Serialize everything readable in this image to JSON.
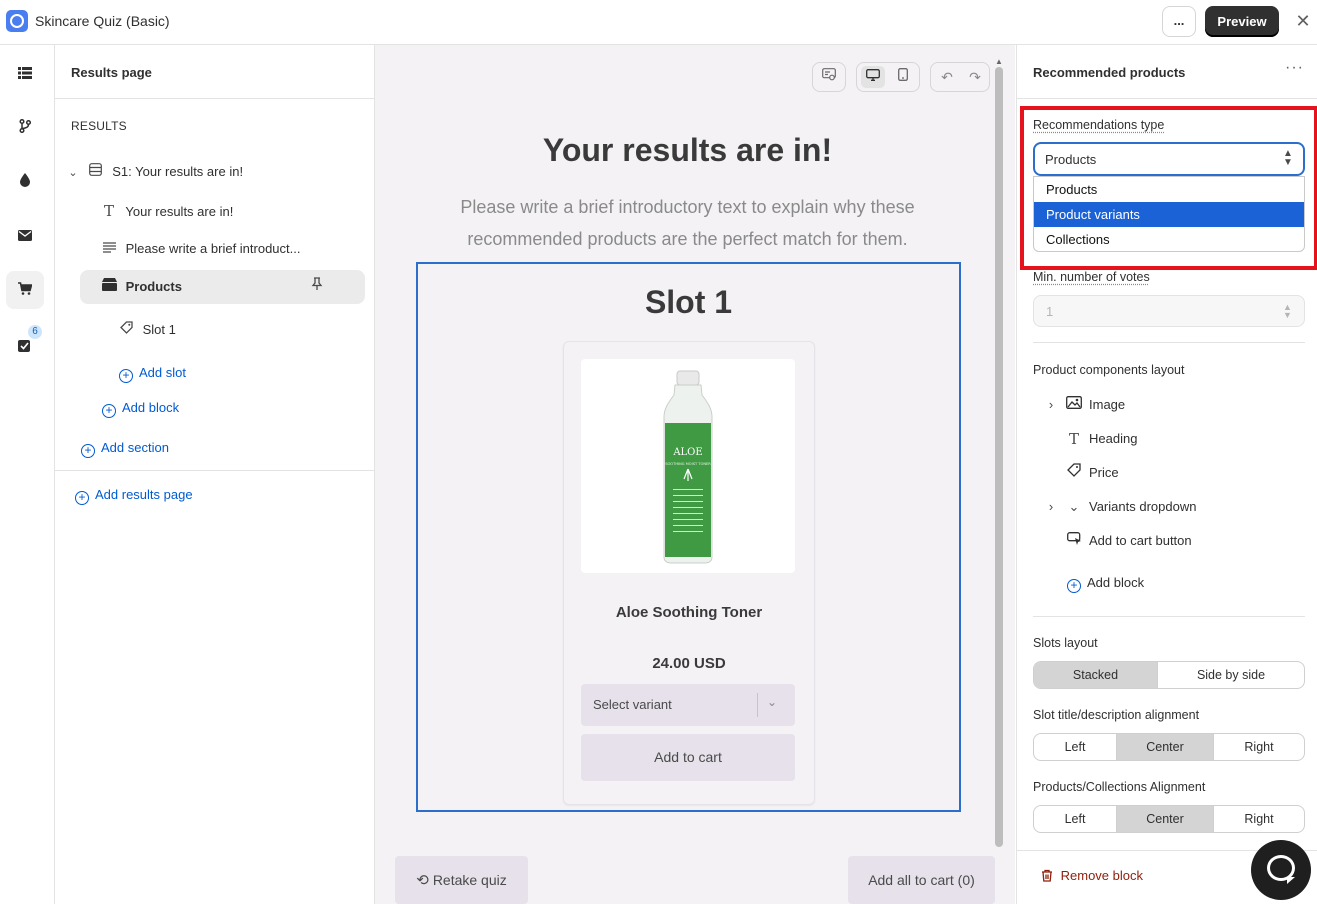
{
  "app": {
    "title": "Skincare Quiz (Basic)",
    "more_label": "...",
    "preview_label": "Preview",
    "close_icon": "close-icon"
  },
  "rail": {
    "badge_count": "6"
  },
  "tree": {
    "header": "Results page",
    "section_label": "RESULTS",
    "items": {
      "section": "S1: Your results are in!",
      "heading": "Your results are in!",
      "text": "Please write a brief introduct...",
      "products": "Products",
      "slot": "Slot 1",
      "add_slot": "Add slot",
      "add_block": "Add block",
      "add_section": "Add section",
      "add_results_page": "Add results page"
    }
  },
  "canvas": {
    "title": "Your results are in!",
    "intro": "Please write a brief introductory text to explain why these recommended products are the perfect match for them.",
    "slot_title": "Slot 1",
    "product": {
      "name": "Aloe Soothing Toner",
      "price": "24.00 USD",
      "variant_placeholder": "Select variant",
      "add_to_cart": "Add to cart",
      "bottle_label": "ALOE",
      "bottle_sub": "SOOTHING MOIST TONER"
    },
    "retake": "Retake quiz",
    "add_all": "Add all to cart (0)"
  },
  "panel": {
    "title": "Recommended products",
    "rec_type_label": "Recommendations type",
    "rec_type_value": "Products",
    "options": [
      "Products",
      "Product variants",
      "Collections"
    ],
    "highlighted_option_index": 1,
    "min_votes_label": "Min. number of votes",
    "min_votes_value": "1",
    "layout_label": "Product components layout",
    "components": [
      "Image",
      "Heading",
      "Price",
      "Variants dropdown",
      "Add to cart button"
    ],
    "add_block": "Add block",
    "slots_layout_label": "Slots layout",
    "slots_layout": [
      "Stacked",
      "Side by side"
    ],
    "slot_align_label": "Slot title/description alignment",
    "align_options": [
      "Left",
      "Center",
      "Right"
    ],
    "products_align_label": "Products/Collections Alignment",
    "remove_block": "Remove block"
  },
  "colors": {
    "accent": "#005bd3",
    "selection_frame": "#2c6ecb",
    "highlight_box": "#e5131b",
    "option_highlight": "#1a62d6"
  }
}
